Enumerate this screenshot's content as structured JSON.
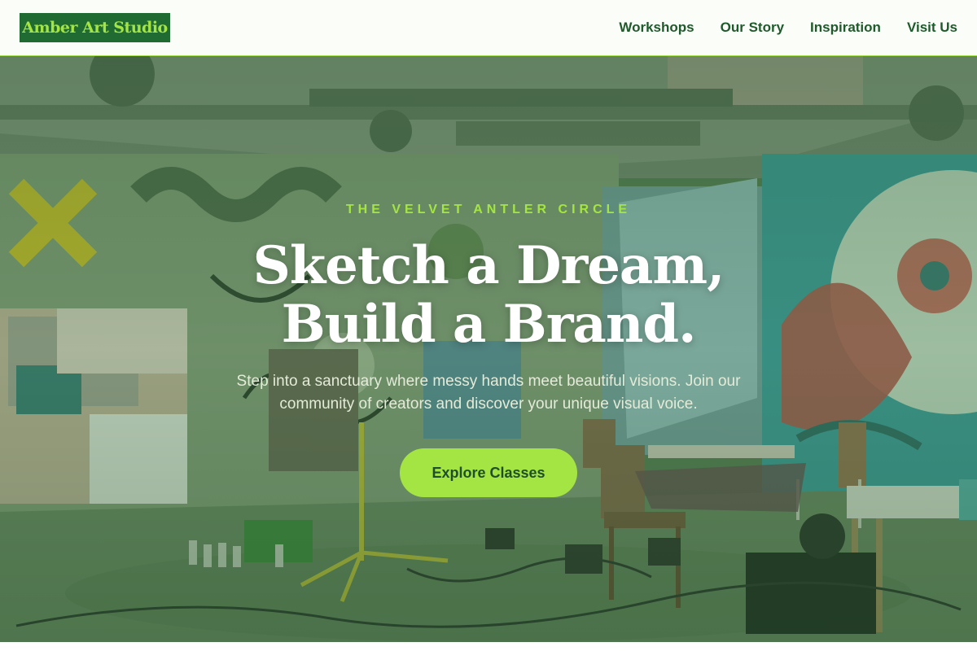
{
  "brand": {
    "name": "Amber Art Studio"
  },
  "nav": {
    "items": [
      {
        "label": "Workshops"
      },
      {
        "label": "Our Story"
      },
      {
        "label": "Inspiration"
      },
      {
        "label": "Visit Us"
      }
    ]
  },
  "hero": {
    "eyebrow": "THE VELVET ANTLER CIRCLE",
    "headline_line1": "Sketch a Dream,",
    "headline_line2": "Build a Brand.",
    "subtext": "Step into a sanctuary where messy hands meet beautiful visions. Join our community of creators and discover your unique visual voice.",
    "cta_label": "Explore Classes",
    "background_image": "graffiti art studio interior with chairs, easels and spray cans"
  },
  "colors": {
    "accent": "#a4e544",
    "brand_green": "#206b32",
    "nav_text": "#1f5a2c",
    "header_bg": "#fbfdf8"
  }
}
